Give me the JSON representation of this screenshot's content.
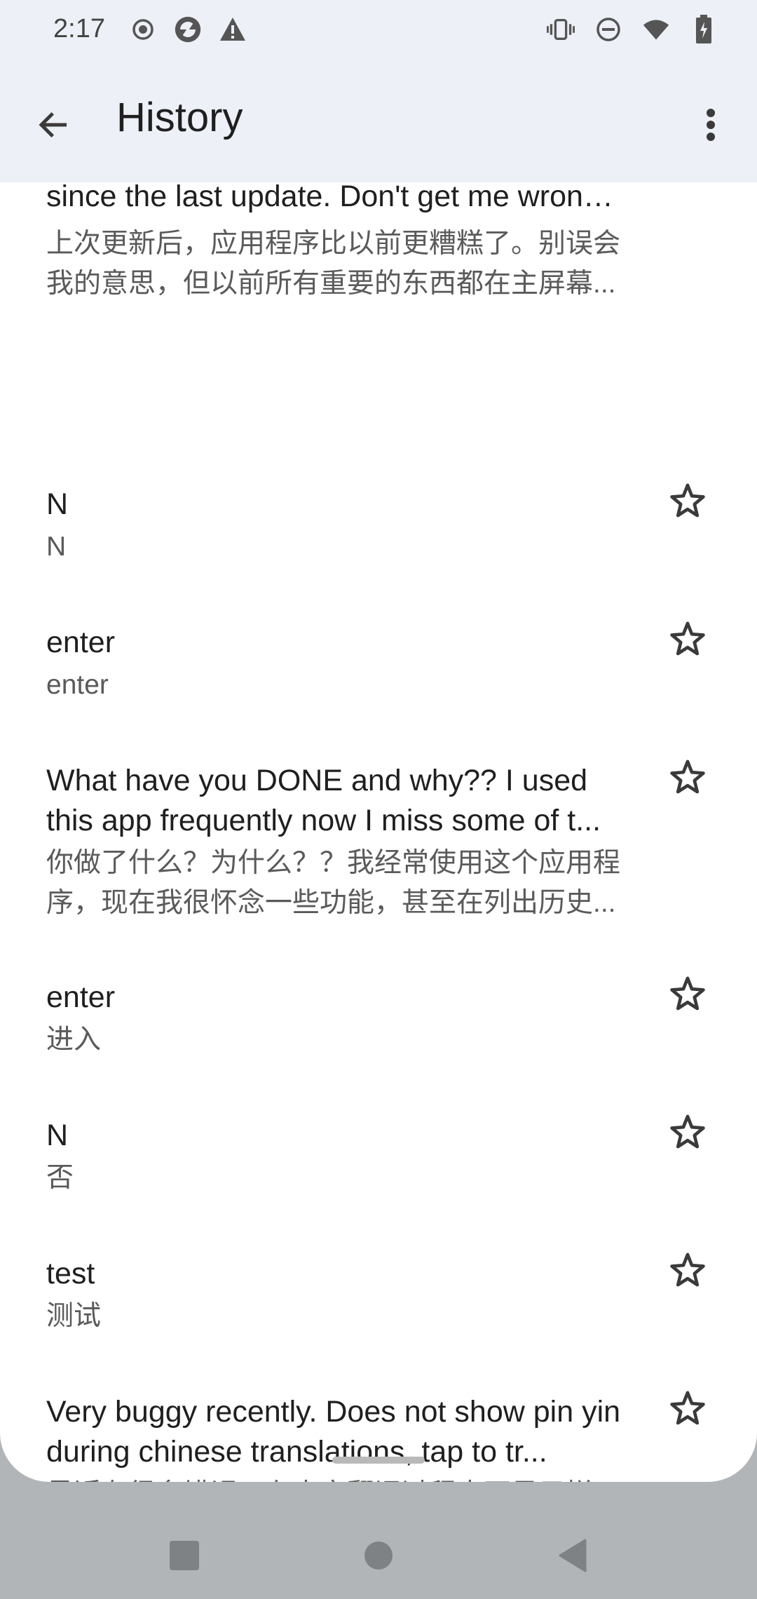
{
  "status_bar": {
    "time": "2:17",
    "left_icons": [
      "record-icon",
      "app-icon",
      "warning-icon"
    ],
    "right_icons": [
      "vibrate-icon",
      "dnd-icon",
      "wifi-icon",
      "battery-icon"
    ]
  },
  "app_bar": {
    "title": "History",
    "back_icon": "arrow-back-icon",
    "more_icon": "more-vert-icon"
  },
  "history": [
    {
      "source": "The app has gotten worse than before since the last update. Don't get me wrong, but before ...",
      "translation": "上次更新后，应用程序比以前更糟糕了。别误会我的意思，但以前所有重要的东西都在主屏幕...",
      "starred": false
    },
    {
      "source": "N",
      "translation": "N",
      "starred": false
    },
    {
      "source": "enter",
      "translation": "enter",
      "starred": false
    },
    {
      "source": "What have you DONE and why?? I used this app frequently now I miss some of t...",
      "translation": "你做了什么？为什么？？我经常使用这个应用程序，现在我很怀念一些功能，甚至在列出历史...",
      "starred": false
    },
    {
      "source": "enter",
      "translation": "进入",
      "starred": false
    },
    {
      "source": "N",
      "translation": "否",
      "starred": false
    },
    {
      "source": "test",
      "translation": "测试",
      "starred": false
    },
    {
      "source": "Very buggy recently. Does not show pin yin during chinese translations, tap to tr...",
      "translation": "最近有很多错误。在中文翻译过程中不显示拼音，点击翻译时有持续的通知，访问翻译时屏...",
      "starred": false
    }
  ],
  "nav_bar": {
    "icons": [
      "recents-square-icon",
      "home-circle-icon",
      "back-triangle-icon"
    ]
  },
  "colors": {
    "app_bar_bg": "#edf0f6",
    "sheet_bg": "#ffffff",
    "nav_bg": "#b2b5b8"
  }
}
